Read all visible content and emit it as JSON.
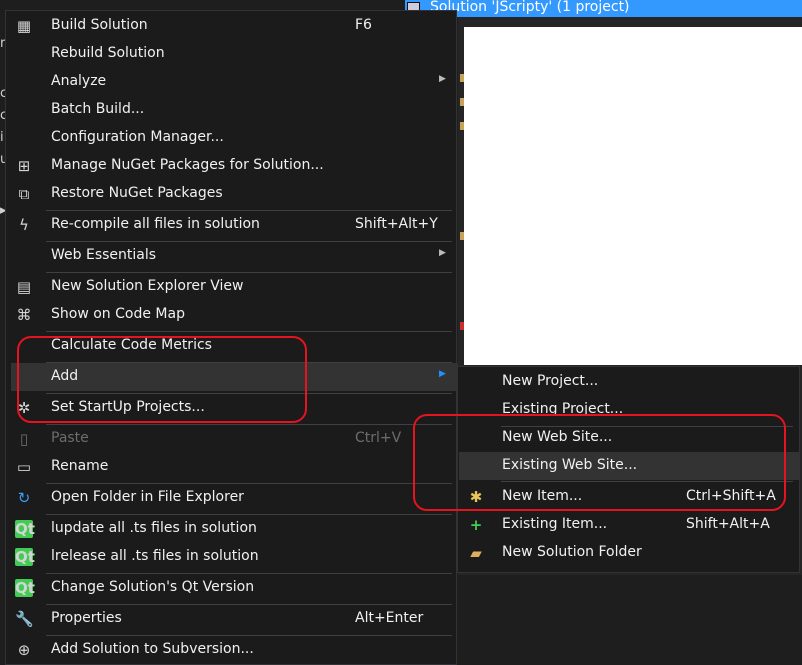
{
  "solution_explorer": {
    "header": "Solution 'JScripty' (1 project)",
    "left_chars": [
      "r",
      "c",
      "c",
      "i",
      "u",
      "▸"
    ]
  },
  "main_menu": {
    "items": [
      {
        "label": "Build Solution",
        "shortcut": "F6",
        "icon": "build-icon",
        "glyph": "▦"
      },
      {
        "label": "Rebuild Solution",
        "shortcut": "",
        "icon": "",
        "glyph": ""
      },
      {
        "label": "Analyze",
        "shortcut": "",
        "icon": "",
        "glyph": "",
        "submenu": true
      },
      {
        "label": "Batch Build...",
        "shortcut": "",
        "icon": "",
        "glyph": ""
      },
      {
        "label": "Configuration Manager...",
        "shortcut": "",
        "icon": "",
        "glyph": ""
      },
      {
        "label": "Manage NuGet Packages for Solution...",
        "shortcut": "",
        "icon": "nuget-icon",
        "glyph": "⊞"
      },
      {
        "label": "Restore NuGet Packages",
        "shortcut": "",
        "icon": "restore-icon",
        "glyph": "⧉"
      },
      {
        "label": "Re-compile all files in solution",
        "shortcut": "Shift+Alt+Y",
        "icon": "lightning-icon",
        "glyph": "ϟ"
      },
      {
        "label": "Web Essentials",
        "shortcut": "",
        "icon": "",
        "glyph": "",
        "submenu": true
      },
      {
        "label": "New Solution Explorer View",
        "shortcut": "",
        "icon": "explorer-view-icon",
        "glyph": "▤"
      },
      {
        "label": "Show on Code Map",
        "shortcut": "",
        "icon": "code-map-icon",
        "glyph": "⌘"
      },
      {
        "label": "Calculate Code Metrics",
        "shortcut": "",
        "icon": "",
        "glyph": ""
      },
      {
        "label": "Add",
        "shortcut": "",
        "icon": "",
        "glyph": "",
        "submenu": true,
        "highlighted": true
      },
      {
        "label": "Set StartUp Projects...",
        "shortcut": "",
        "icon": "gear-icon",
        "glyph": "✲"
      },
      {
        "label": "Paste",
        "shortcut": "Ctrl+V",
        "icon": "paste-icon",
        "glyph": "▯",
        "disabled": true
      },
      {
        "label": "Rename",
        "shortcut": "",
        "icon": "rename-icon",
        "glyph": "▭"
      },
      {
        "label": "Open Folder in File Explorer",
        "shortcut": "",
        "icon": "refresh-arrow-icon",
        "glyph": "↻"
      },
      {
        "label": "lupdate all .ts files in solution",
        "shortcut": "",
        "icon": "qt-icon",
        "glyph": "Qt"
      },
      {
        "label": "lrelease all .ts files in solution",
        "shortcut": "",
        "icon": "qt-icon",
        "glyph": "Qt"
      },
      {
        "label": "Change Solution's Qt Version",
        "shortcut": "",
        "icon": "qt-icon",
        "glyph": "Qt"
      },
      {
        "label": "Properties",
        "shortcut": "Alt+Enter",
        "icon": "wrench-icon",
        "glyph": "🔧"
      },
      {
        "label": "Add Solution to Subversion...",
        "shortcut": "",
        "icon": "subversion-icon",
        "glyph": "⊕"
      }
    ]
  },
  "add_submenu": {
    "items": [
      {
        "label": "New Project...",
        "shortcut": "",
        "icon": "",
        "glyph": ""
      },
      {
        "label": "Existing Project...",
        "shortcut": "",
        "icon": "",
        "glyph": ""
      },
      {
        "label": "New Web Site...",
        "shortcut": "",
        "icon": "",
        "glyph": ""
      },
      {
        "label": "Existing Web Site...",
        "shortcut": "",
        "icon": "",
        "glyph": "",
        "highlighted": true
      },
      {
        "label": "New Item...",
        "shortcut": "Ctrl+Shift+A",
        "icon": "new-item-icon",
        "glyph": "✱"
      },
      {
        "label": "Existing Item...",
        "shortcut": "Shift+Alt+A",
        "icon": "existing-item-icon",
        "glyph": "+"
      },
      {
        "label": "New Solution Folder",
        "shortcut": "",
        "icon": "folder-icon",
        "glyph": "▰"
      }
    ]
  },
  "colors": {
    "menu_bg": "#1b1b1c",
    "highlight": "#333334",
    "annotation_red": "#e5141e",
    "selection_blue": "#3399ff",
    "submenu_arrow_active": "#1e90ff"
  }
}
